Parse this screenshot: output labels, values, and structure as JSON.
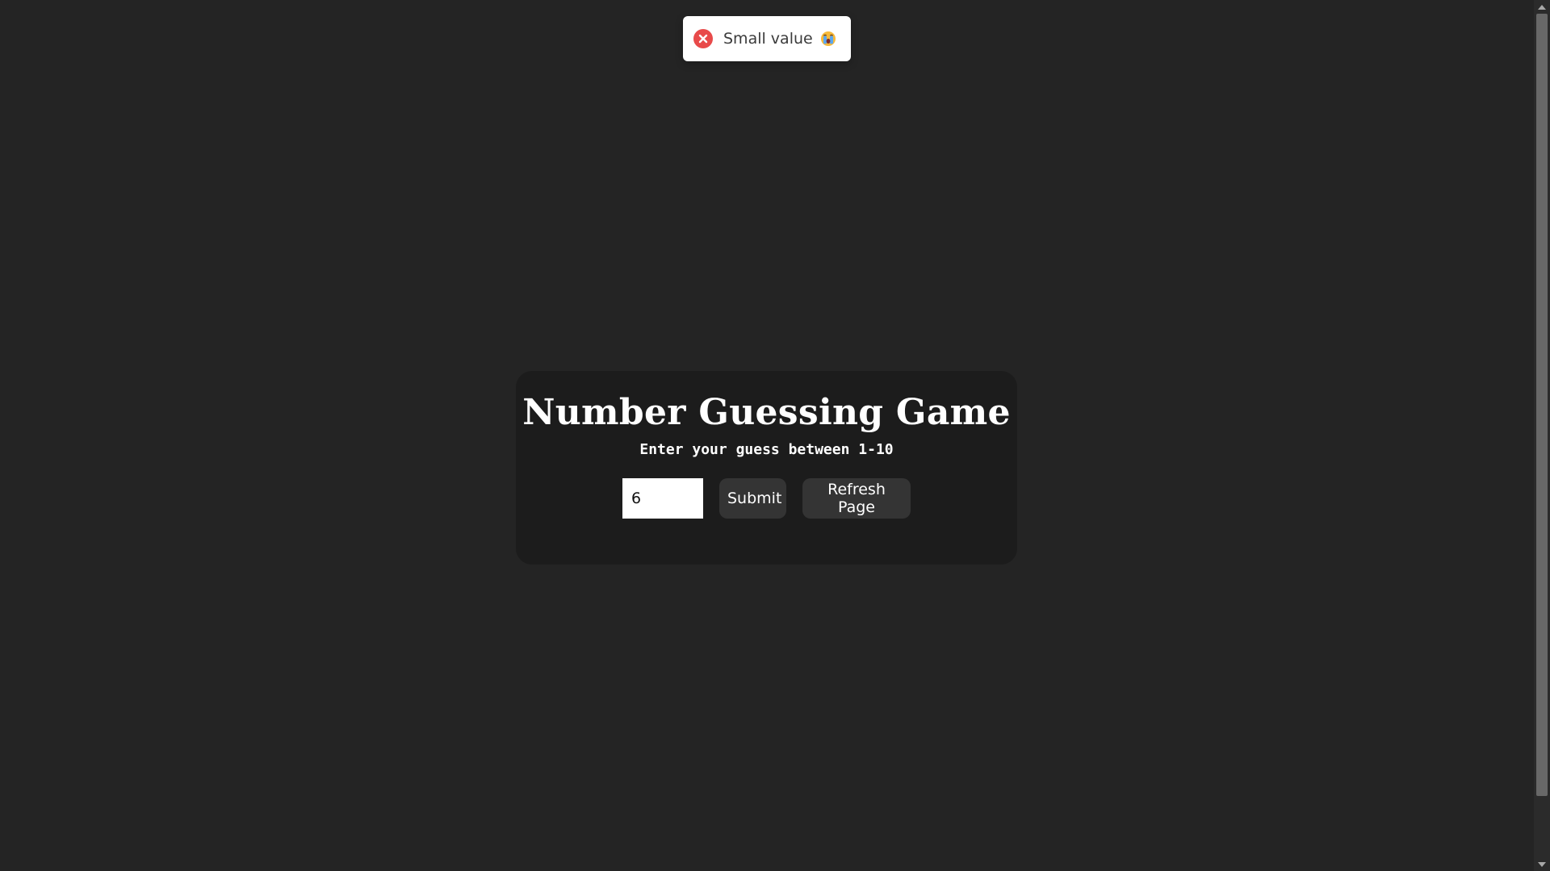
{
  "toast": {
    "message": "Small value",
    "status_icon": "error-x-icon",
    "emoji_icon": "crying-face-icon",
    "status_color": "#e84a4a"
  },
  "game": {
    "title": "Number Guessing Game",
    "subtitle": "Enter your guess between 1-10",
    "guess_value": "6",
    "submit_label": "Submit",
    "refresh_label": "Refresh Page"
  },
  "colors": {
    "background": "#242424",
    "card": "#1c1c1c",
    "button": "#343434",
    "text": "#ffffff"
  }
}
